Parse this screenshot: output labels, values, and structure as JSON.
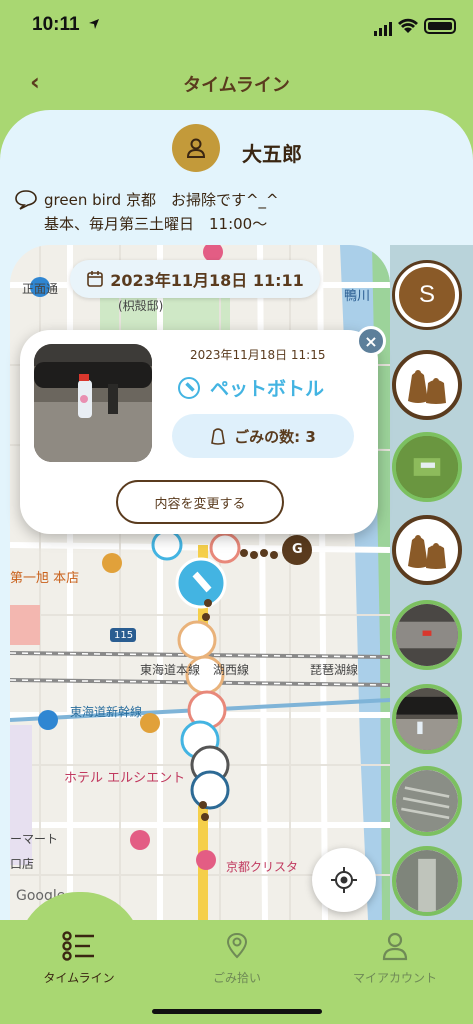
{
  "status_bar": {
    "time": "10:11"
  },
  "header": {
    "back_label": "‹",
    "title": "タイムライン"
  },
  "profile": {
    "name": "大五郎",
    "description_line1": "green bird 京都　お掃除です^_^",
    "description_line2": "基本、毎月第三土曜日　11:00〜"
  },
  "map": {
    "date_filter": "2023年11月18日 11:11",
    "labels": [
      "正面通",
      "(枳殻邸)",
      "鴨川",
      "第一旭 本店",
      "東海道本線",
      "湖西線",
      "琵琶湖線",
      "東海道新幹線",
      "ホテル エルシエント",
      "ーマート",
      "口店",
      "京都クリスタ",
      "115",
      "G",
      "Google"
    ]
  },
  "popup": {
    "timestamp": "2023年11月18日 11:15",
    "trash_type": "ペットボトル",
    "count_label": "ごみの数: 3",
    "edit_label": "内容を変更する",
    "close_label": "×"
  },
  "rail": {
    "user_initial": "S"
  },
  "tabs": [
    {
      "label": "タイムライン",
      "icon": "timeline-icon",
      "active": true
    },
    {
      "label": "ごみ拾い",
      "icon": "pickup-icon",
      "active": false
    },
    {
      "label": "マイアカウント",
      "icon": "account-icon",
      "active": false
    }
  ],
  "colors": {
    "accent_green": "#a9d772",
    "brown": "#5a3b1e",
    "blue": "#43b4e2",
    "panel_bg": "#e3f4fc"
  }
}
